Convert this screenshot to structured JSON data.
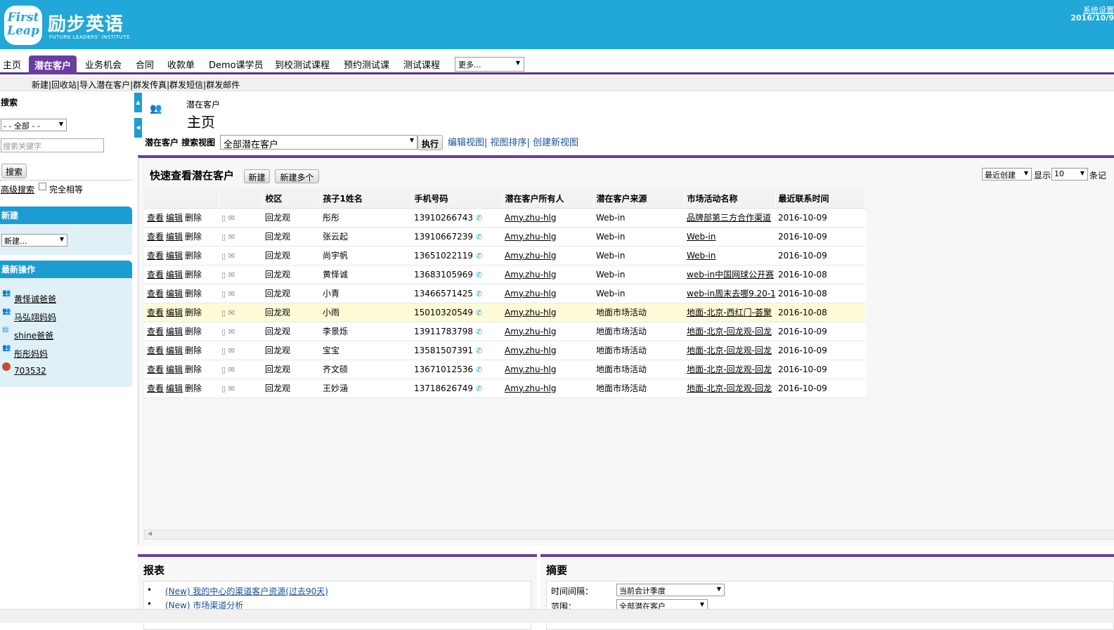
{
  "header": {
    "logo_line1": "First",
    "logo_line2": "Leap",
    "brand_cn": "励步英语",
    "brand_en": "FUTURE LEADERS' INSTITUTE",
    "system_settings": "系统设置",
    "date": "2016/10/9"
  },
  "tabs": [
    "主页",
    "潜在客户",
    "业务机会",
    "合同",
    "收款单",
    "Demo课学员",
    "到校测试课程",
    "预约测试课",
    "测试课程"
  ],
  "more_select": "更多...",
  "subnav": "新建|回收站|导入潜在客户|群发传真|群发短信|群发邮件",
  "sidebar": {
    "search_title": "搜索",
    "scope_select": "- - 全部 - -",
    "keyword_placeholder": "搜索关键字",
    "search_button": "搜索",
    "advanced_search": "高级搜索",
    "exact_match": "完全相等",
    "new_title": "新建",
    "new_select": "新建...",
    "recent_title": "最新操作",
    "recent": [
      "黄怿诚爸爸",
      "马弘翊妈妈",
      "shine爸爸",
      "彤彤妈妈",
      "703532"
    ]
  },
  "page": {
    "object_name": "潜在客户",
    "title": "主页",
    "view_label": "潜在客户 搜索视图",
    "view_select": "全部潜在客户",
    "execute_button": "执行",
    "view_links": "编辑视图| 视图排序| 创建新视图"
  },
  "list": {
    "title": "快速查看潜在客户",
    "new_button": "新建",
    "new_many_button": "新建多个",
    "sort_select": "最近创建",
    "show_label": "显示",
    "show_select": "10",
    "records_label": "条记",
    "columns": [
      "",
      "",
      "校区",
      "孩子1姓名",
      "手机号码",
      "潜在客户所有人",
      "潜在客户来源",
      "市场活动名称",
      "最近联系时间"
    ],
    "actions": {
      "view": "查看",
      "edit": "编辑",
      "delete": "删除"
    },
    "rows": [
      {
        "campus": "回龙观",
        "child": "彤彤",
        "phone": "13910266743",
        "owner": "Amy.zhu-hlg",
        "source": "Web-in",
        "campaign": "品牌部第三方合作渠道",
        "date": "2016-10-09"
      },
      {
        "campus": "回龙观",
        "child": "张云起",
        "phone": "13910667239",
        "owner": "Amy.zhu-hlg",
        "source": "Web-in",
        "campaign": "Web-in",
        "date": "2016-10-09"
      },
      {
        "campus": "回龙观",
        "child": "尚宇帆",
        "phone": "13651022119",
        "owner": "Amy.zhu-hlg",
        "source": "Web-in",
        "campaign": "Web-in",
        "date": "2016-10-09"
      },
      {
        "campus": "回龙观",
        "child": "黄怿诚",
        "phone": "13683105969",
        "owner": "Amy.zhu-hlg",
        "source": "Web-in",
        "campaign": "web-in中国网球公开赛",
        "date": "2016-10-08"
      },
      {
        "campus": "回龙观",
        "child": "小青",
        "phone": "13466571425",
        "owner": "Amy.zhu-hlg",
        "source": "Web-in",
        "campaign": "web-in周末去哪9.20-1",
        "date": "2016-10-08"
      },
      {
        "campus": "回龙观",
        "child": "小雨",
        "phone": "15010320549",
        "owner": "Amy.zhu-hlg",
        "source": "地面市场活动",
        "campaign": "地面-北京-西红门-荟聚",
        "date": "2016-10-08"
      },
      {
        "campus": "回龙观",
        "child": "李景烁",
        "phone": "13911783798",
        "owner": "Amy.zhu-hlg",
        "source": "地面市场活动",
        "campaign": "地面-北京-回龙观-回龙",
        "date": "2016-10-09"
      },
      {
        "campus": "回龙观",
        "child": "宝宝",
        "phone": "13581507391",
        "owner": "Amy.zhu-hlg",
        "source": "地面市场活动",
        "campaign": "地面-北京-回龙观-回龙",
        "date": "2016-10-09"
      },
      {
        "campus": "回龙观",
        "child": "齐文硕",
        "phone": "13671012536",
        "owner": "Amy.zhu-hlg",
        "source": "地面市场活动",
        "campaign": "地面-北京-回龙观-回龙",
        "date": "2016-10-09"
      },
      {
        "campus": "回龙观",
        "child": "王妙涵",
        "phone": "13718626749",
        "owner": "Amy.zhu-hlg",
        "source": "地面市场活动",
        "campaign": "地面-北京-回龙观-回龙",
        "date": "2016-10-09"
      }
    ]
  },
  "reports": {
    "title": "报表",
    "items": [
      "(New) 我的中心的渠道客户资源(过去90天)",
      "(New) 市场渠道分析"
    ]
  },
  "summary": {
    "title": "摘要",
    "interval_label": "时间间隔：",
    "interval_value": "当前会计季度",
    "scope_label": "范围：",
    "scope_value": "全部潜在客户"
  }
}
